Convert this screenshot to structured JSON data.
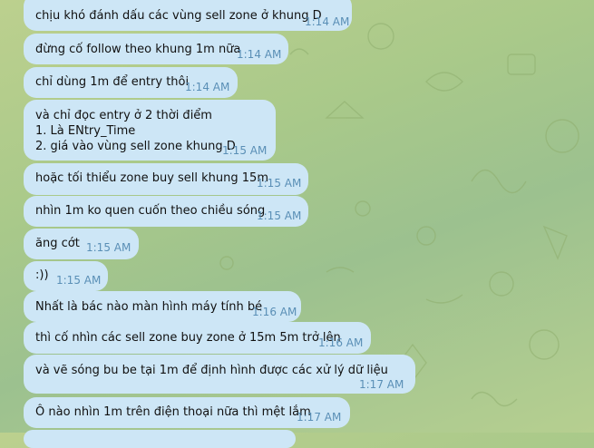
{
  "messages": [
    {
      "text": "chịu khó đánh dấu các vùng sell zone ở khung D",
      "time": "1:14 AM"
    },
    {
      "text": "đừng cố follow theo khung 1m nữa",
      "time": "1:14 AM"
    },
    {
      "text": "chỉ dùng 1m để entry thôi",
      "time": "1:14 AM"
    },
    {
      "text": "và chỉ đọc entry ở 2 thời điểm\n1. Là ENtry_Time\n2. giá vào vùng sell zone khung D",
      "time": "1:15 AM"
    },
    {
      "text": "hoặc tối thiểu zone buy sell khung 15m",
      "time": "1:15 AM"
    },
    {
      "text": "nhìn 1m ko quen cuốn theo chiều sóng",
      "time": "1:15 AM"
    },
    {
      "text": "ăng cớt",
      "time": "1:15 AM"
    },
    {
      "text": ":))",
      "time": "1:15 AM"
    },
    {
      "text": "Nhất là bác nào màn hình máy tính bé",
      "time": "1:16 AM"
    },
    {
      "text": "thì cố nhìn các sell zone buy zone ở 15m 5m trở lên",
      "time": "1:16 AM"
    },
    {
      "text": "và vẽ sóng bu be tại 1m để định hình được các xử lý dữ liệu",
      "time": "1:17 AM"
    },
    {
      "text": "Ô nào nhìn 1m trên điện thoại nữa thì mệt lắm",
      "time": "1:17 AM"
    }
  ],
  "colors": {
    "bubble": "#cde6f6",
    "time": "#5a8fb6",
    "background": "#a9c98a"
  }
}
